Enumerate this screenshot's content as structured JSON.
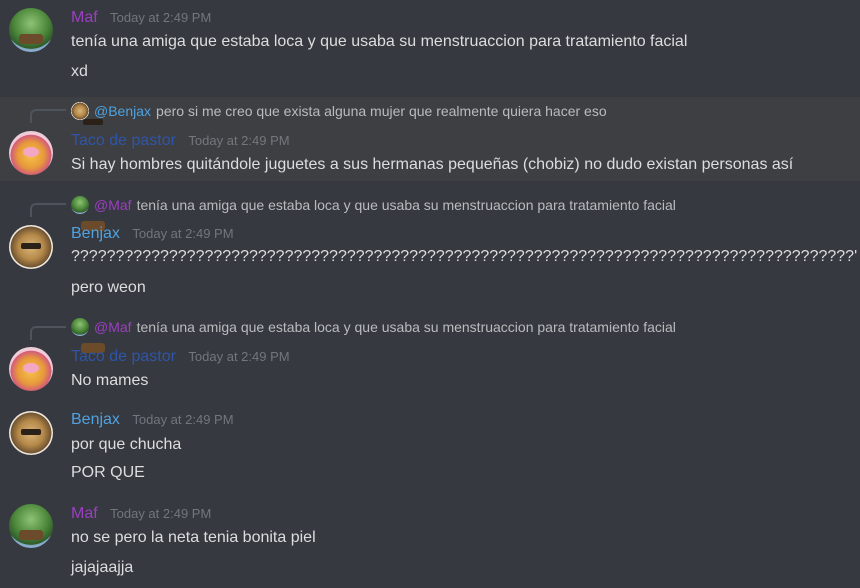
{
  "messages": [
    {
      "author": "Maf",
      "timestamp": "Today at 2:49 PM",
      "lines": [
        "tenía una amiga que estaba loca y que usaba su menstruaccion para tratamiento facial",
        "xd"
      ]
    },
    {
      "author": "Taco de pastor",
      "timestamp": "Today at 2:49 PM",
      "reply": {
        "mention": "@Benjax",
        "text": "pero si me creo que exista alguna mujer que realmente quiera hacer eso"
      },
      "lines": [
        "Si hay hombres quitándole juguetes a sus hermanas pequeñas (chobiz) no dudo existan personas así"
      ]
    },
    {
      "author": "Benjax",
      "timestamp": "Today at 2:49 PM",
      "reply": {
        "mention": "@Maf",
        "text": "tenía una amiga que estaba loca y que usaba su menstruaccion para tratamiento facial"
      },
      "lines": [
        "????????????????????????????????????????????????????????????????????????????????????????'",
        "pero weon"
      ]
    },
    {
      "author": "Taco de pastor",
      "timestamp": "Today at 2:49 PM",
      "reply": {
        "mention": "@Maf",
        "text": "tenía una amiga que estaba loca y que usaba su menstruaccion para tratamiento facial"
      },
      "lines": [
        "No mames"
      ]
    },
    {
      "author": "Benjax",
      "timestamp": "Today at 2:49 PM",
      "lines": [
        "por que chucha",
        "POR QUE"
      ]
    },
    {
      "author": "Maf",
      "timestamp": "Today at 2:49 PM",
      "lines": [
        "no se pero la neta tenia bonita piel",
        "jajajaajja"
      ]
    }
  ]
}
